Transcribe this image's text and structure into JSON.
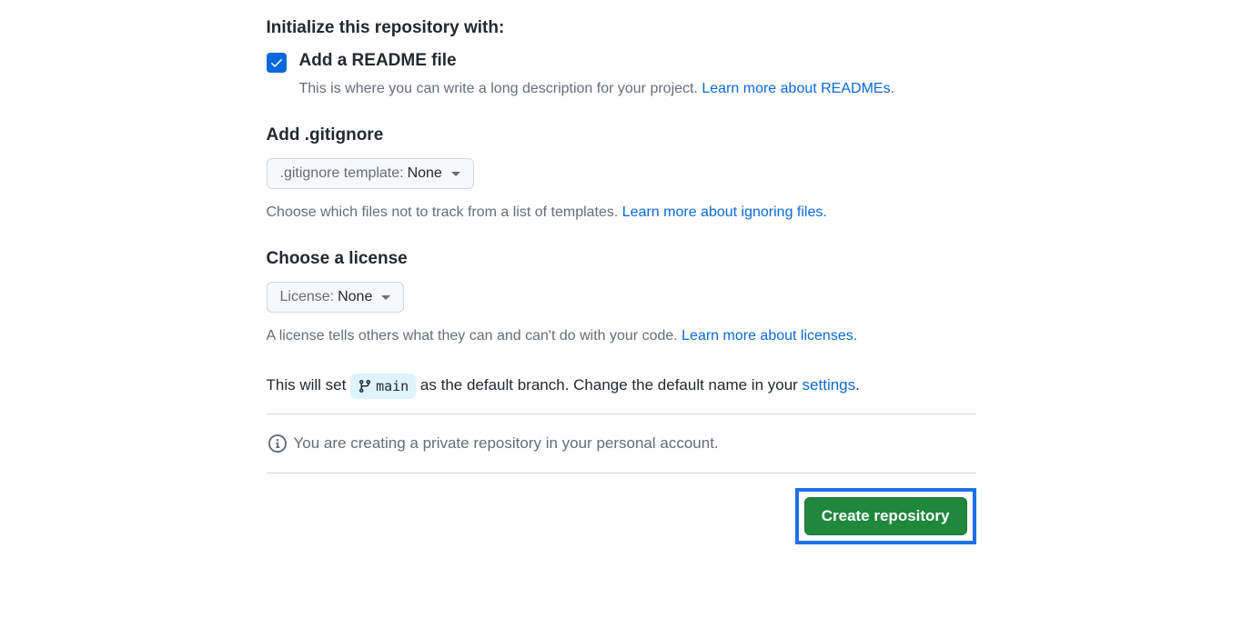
{
  "initialize": {
    "heading": "Initialize this repository with:",
    "readme": {
      "label": "Add a README file",
      "description": "This is where you can write a long description for your project. ",
      "link_text": "Learn more about READMEs."
    }
  },
  "gitignore": {
    "heading": "Add .gitignore",
    "dropdown_prefix": ".gitignore template:",
    "dropdown_value": "None",
    "description": "Choose which files not to track from a list of templates. ",
    "link_text": "Learn more about ignoring files."
  },
  "license": {
    "heading": "Choose a license",
    "dropdown_prefix": "License:",
    "dropdown_value": "None",
    "description": "A license tells others what they can and can't do with your code. ",
    "link_text": "Learn more about licenses."
  },
  "branch": {
    "prefix": "This will set ",
    "branch_name": "main",
    "middle": " as the default branch. Change the default name in your ",
    "settings_link": "settings",
    "suffix": "."
  },
  "info_message": "You are creating a private repository in your personal account.",
  "create_button": "Create repository"
}
